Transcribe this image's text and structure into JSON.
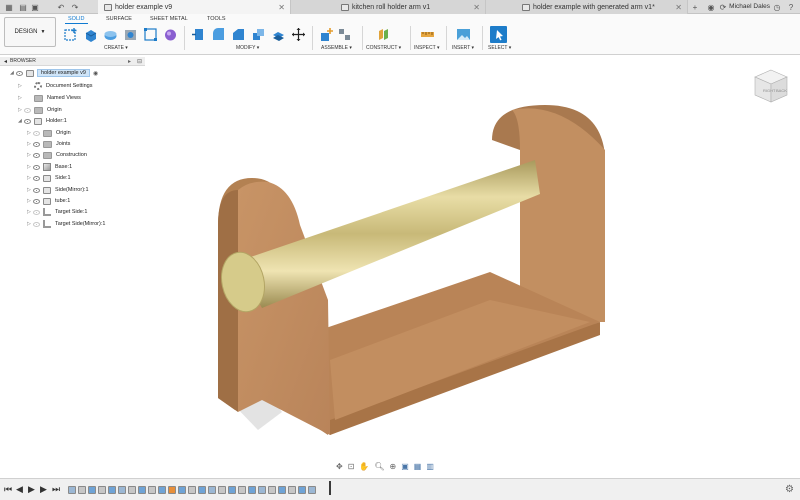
{
  "tabs": [
    {
      "label": "holder example v9",
      "active": true
    },
    {
      "label": "kitchen roll holder arm v1",
      "active": false
    },
    {
      "label": "holder example with generated arm v1*",
      "active": false
    }
  ],
  "user_name": "Michael Dales",
  "workspace": {
    "label": "DESIGN",
    "tabs": [
      "SOLID",
      "SURFACE",
      "SHEET METAL",
      "TOOLS"
    ],
    "active_tab": "SOLID"
  },
  "toolbar_groups": [
    "CREATE",
    "MODIFY",
    "ASSEMBLE",
    "CONSTRUCT",
    "INSPECT",
    "INSERT",
    "SELECT"
  ],
  "browser": {
    "title": "BROWSER",
    "items": [
      {
        "label": "holder example v9"
      },
      {
        "label": "Document Settings"
      },
      {
        "label": "Named Views"
      },
      {
        "label": "Origin"
      },
      {
        "label": "Holder:1"
      },
      {
        "label": "Origin"
      },
      {
        "label": "Joints"
      },
      {
        "label": "Construction"
      },
      {
        "label": "Base:1"
      },
      {
        "label": "Side:1"
      },
      {
        "label": "Side(Mirror):1"
      },
      {
        "label": "tube:1"
      },
      {
        "label": "Target Side:1"
      },
      {
        "label": "Target Side(Mirror):1"
      }
    ]
  },
  "viewcube": {
    "faces": [
      "RIGHT",
      "BACK"
    ]
  },
  "colors": {
    "accent": "#0f7ad1",
    "wood": "#c79466",
    "brass": "#d8c98a"
  }
}
